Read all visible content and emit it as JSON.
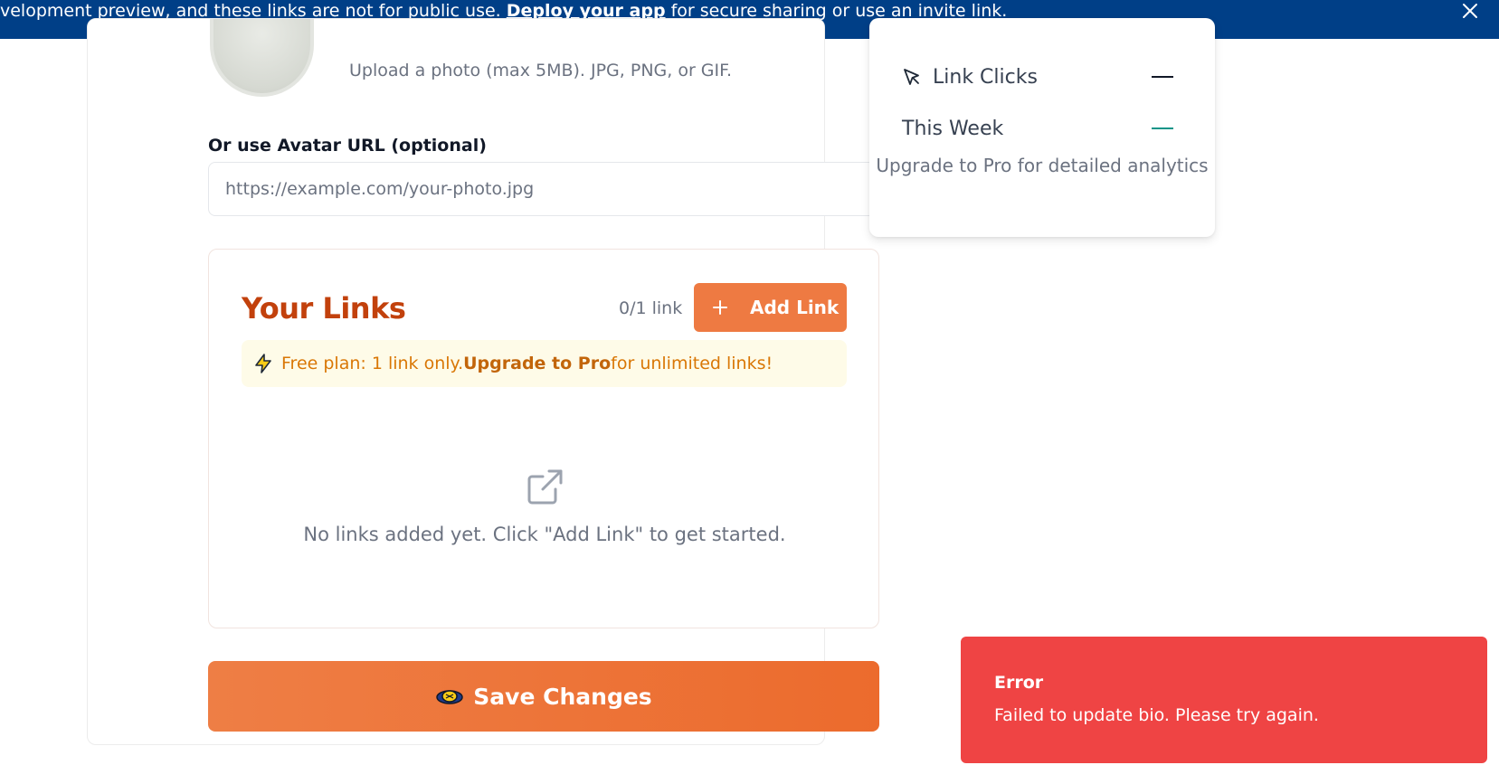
{
  "banner": {
    "text_before": "velopment preview, and these links are not for public use. ",
    "link_text": "Deploy your app",
    "text_after": " for secure sharing or use an invite link."
  },
  "profile": {
    "upload_hint": "Upload a photo (max 5MB). JPG, PNG, or GIF.",
    "avatar_url_label": "Or use Avatar URL (optional)",
    "avatar_url_placeholder": "https://example.com/your-photo.jpg",
    "avatar_url_value": ""
  },
  "links": {
    "title": "Your Links",
    "count": "0/1 link",
    "add_button": "Add Link",
    "free_plan_prefix": "Free plan: 1 link only. ",
    "free_plan_upgrade": "Upgrade to Pro",
    "free_plan_suffix": " for unlimited links!",
    "empty_message": "No links added yet. Click \"Add Link\" to get started."
  },
  "save_button": "Save Changes",
  "stats": {
    "link_clicks_label": "Link Clicks",
    "link_clicks_value": "—",
    "this_week_label": "This Week",
    "this_week_value": "—",
    "upgrade_note": "Upgrade to Pro for detailed analytics"
  },
  "toast": {
    "title": "Error",
    "message": "Failed to update bio. Please try again."
  },
  "colors": {
    "banner": "#003f87",
    "accent": "#ee7a42",
    "title": "#c2410c",
    "free_plan_bg": "#fefbe8",
    "error": "#ef4444",
    "week_dash": "#0d9488"
  }
}
